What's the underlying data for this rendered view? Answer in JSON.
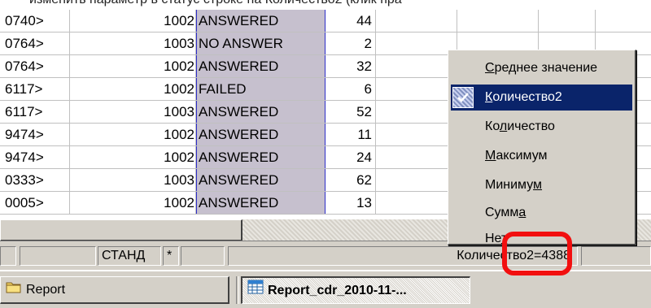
{
  "caption": "изменить параметр в статус строке на Количество2 (клик пра",
  "rows": [
    {
      "a": "0740>",
      "b": "1002",
      "c": "ANSWERED",
      "d": "44"
    },
    {
      "a": "0764>",
      "b": "1003",
      "c": "NO ANSWER",
      "d": "2"
    },
    {
      "a": "0764>",
      "b": "1002",
      "c": "ANSWERED",
      "d": "32"
    },
    {
      "a": "6117>",
      "b": "1002",
      "c": "FAILED",
      "d": "6"
    },
    {
      "a": "6117>",
      "b": "1003",
      "c": "ANSWERED",
      "d": "52"
    },
    {
      "a": "9474>",
      "b": "1002",
      "c": "ANSWERED",
      "d": "11"
    },
    {
      "a": "9474>",
      "b": "1002",
      "c": "ANSWERED",
      "d": "24"
    },
    {
      "a": "0333>",
      "b": "1003",
      "c": "ANSWERED",
      "d": "62"
    },
    {
      "a": "0005>",
      "b": "1002",
      "c": "ANSWERED",
      "d": "13"
    }
  ],
  "context_menu": {
    "items": [
      {
        "pre": "",
        "u": "С",
        "post": "реднее значение",
        "selected": false
      },
      {
        "pre": "",
        "u": "К",
        "post": "оличество2",
        "selected": true,
        "checked": true
      },
      {
        "pre": "Ко",
        "u": "л",
        "post": "ичество",
        "selected": false
      },
      {
        "pre": "",
        "u": "М",
        "post": "аксимум",
        "selected": false
      },
      {
        "pre": "Миниму",
        "u": "м",
        "post": "",
        "selected": false
      },
      {
        "pre": "Сумм",
        "u": "а",
        "post": "",
        "selected": false
      },
      {
        "pre": "Не",
        "u": "т",
        "post": "",
        "selected": false
      }
    ]
  },
  "statusbar": {
    "mode": "СТАНД",
    "star": "*",
    "summary": "Количество2=4388"
  },
  "taskbar": {
    "items": [
      {
        "label": "Report",
        "icon": "folder-icon",
        "active": false
      },
      {
        "label": "Report_cdr_2010-11-...",
        "icon": "spreadsheet-icon",
        "active": true
      }
    ]
  },
  "colors": {
    "selection": "#0a246a",
    "selected_column": "#c6c0ce",
    "highlight": "#f20f0f"
  }
}
